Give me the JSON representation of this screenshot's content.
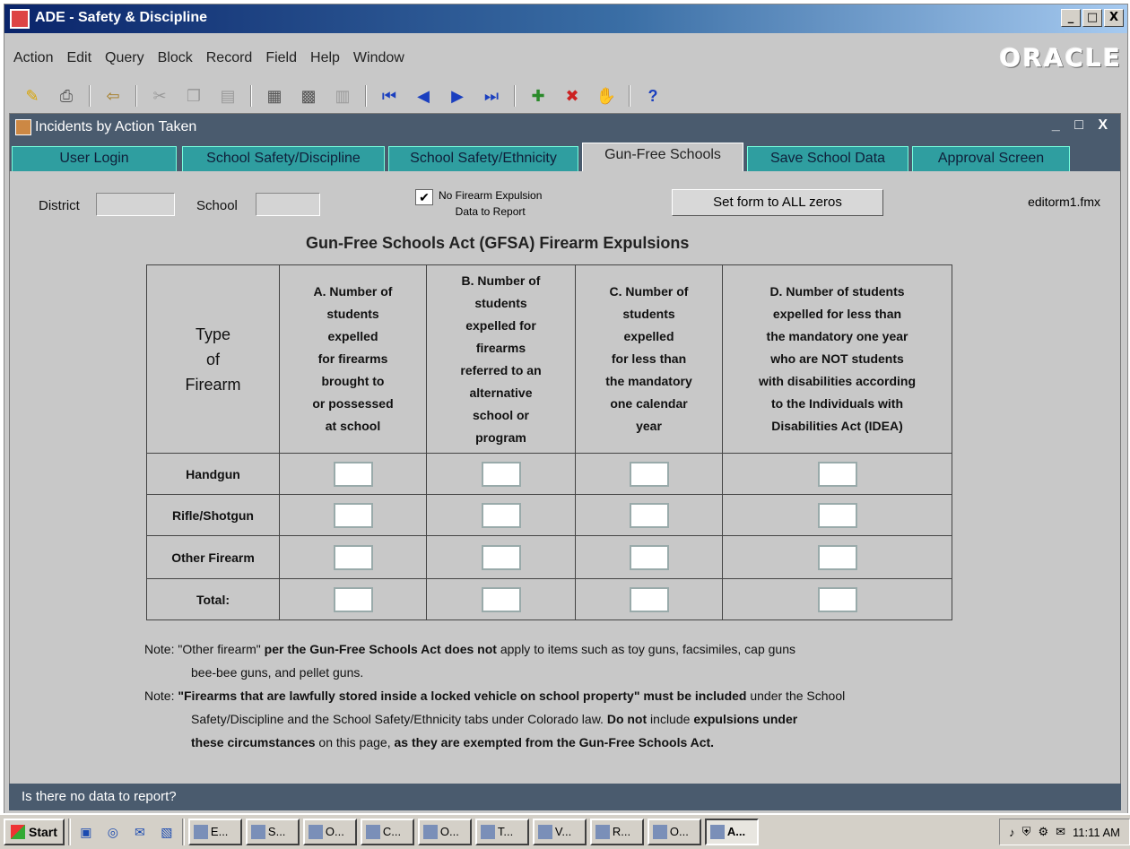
{
  "window": {
    "title": "ADE - Safety & Discipline",
    "min": "_",
    "max": "□",
    "close": "X"
  },
  "menu": [
    "Action",
    "Edit",
    "Query",
    "Block",
    "Record",
    "Field",
    "Help",
    "Window"
  ],
  "brand": "ORACLE",
  "toolbar_icons": [
    "save-icon",
    "print-icon",
    "exit-icon",
    "cut-icon",
    "copy-icon",
    "paste-icon",
    "enter-query-icon",
    "execute-query-icon",
    "cancel-query-icon",
    "first-record-icon",
    "previous-record-icon",
    "next-record-icon",
    "last-record-icon",
    "insert-record-icon",
    "delete-record-icon",
    "lock-record-icon",
    "help-icon"
  ],
  "inner_window": {
    "title": "Incidents by Action Taken",
    "controls": "_ □ X"
  },
  "tabs": [
    {
      "label": "User Login",
      "active": false
    },
    {
      "label": "School Safety/Discipline",
      "active": false
    },
    {
      "label": "School Safety/Ethnicity",
      "active": false
    },
    {
      "label": "Gun-Free Schools",
      "active": true
    },
    {
      "label": "Save School Data",
      "active": false
    },
    {
      "label": "Approval Screen",
      "active": false
    }
  ],
  "form": {
    "district_label": "District",
    "district_value": "",
    "school_label": "School",
    "school_value": "",
    "no_expulsion_checkbox": {
      "checked": true,
      "mark": "✔",
      "label_line1": "No Firearm Expulsion",
      "label_line2": "Data to Report"
    },
    "zero_button": "Set form to ALL zeros",
    "form_name": "editorm1.fmx",
    "heading": "Gun-Free Schools Act (GFSA) Firearm Expulsions"
  },
  "table": {
    "corner_header": [
      "Type",
      "of",
      "Firearm"
    ],
    "columns": [
      [
        "A. Number of",
        "students",
        "expelled",
        "for firearms",
        "brought to",
        "or possessed",
        "at school"
      ],
      [
        "B. Number of",
        "students",
        "expelled for",
        "firearms",
        "referred to an",
        "alternative",
        "school or",
        "program"
      ],
      [
        "C. Number of",
        "students",
        "expelled",
        "for less than",
        "the mandatory",
        "one calendar",
        "year"
      ],
      [
        "D. Number of students",
        "expelled for less than",
        "the mandatory one year",
        "who are NOT students",
        "with disabilities according",
        "to the Individuals with",
        "Disabilities Act (IDEA)"
      ]
    ],
    "rows": [
      {
        "label": "Handgun",
        "values": [
          "",
          "",
          "",
          ""
        ]
      },
      {
        "label": "Rifle/Shotgun",
        "values": [
          "",
          "",
          "",
          ""
        ]
      },
      {
        "label": "Other Firearm",
        "values": [
          "",
          "",
          "",
          ""
        ]
      },
      {
        "label": "Total:",
        "values": [
          "",
          "",
          "",
          ""
        ]
      }
    ]
  },
  "notes": {
    "n1_a": "Note: \"Other firearm\"",
    "n1_b": " per the Gun-Free Schools Act does not",
    "n1_c": " apply to items such as toy guns, facsimiles, cap guns",
    "n1_d": "bee-bee guns, and pellet guns.",
    "n2_a": "Note: ",
    "n2_b": "\"Firearms that are lawfully stored inside a locked vehicle on school property\" must be included",
    "n2_c": " under the School",
    "n2_d": "Safety/Discipline and the School Safety/Ethnicity tabs under Colorado law.  ",
    "n2_e": "Do not",
    "n2_f": " include ",
    "n2_g": "expulsions under",
    "n2_h": "these circumstances",
    "n2_i": " on this page, ",
    "n2_j": "as they are exempted from the Gun-Free Schools Act."
  },
  "status": "Is there no data to report?",
  "taskbar": {
    "start": "Start",
    "tasks": [
      "E...",
      "S...",
      "O...",
      "C...",
      "O...",
      "T...",
      "V...",
      "R...",
      "O...",
      "A..."
    ],
    "clock": "11:11 AM"
  }
}
